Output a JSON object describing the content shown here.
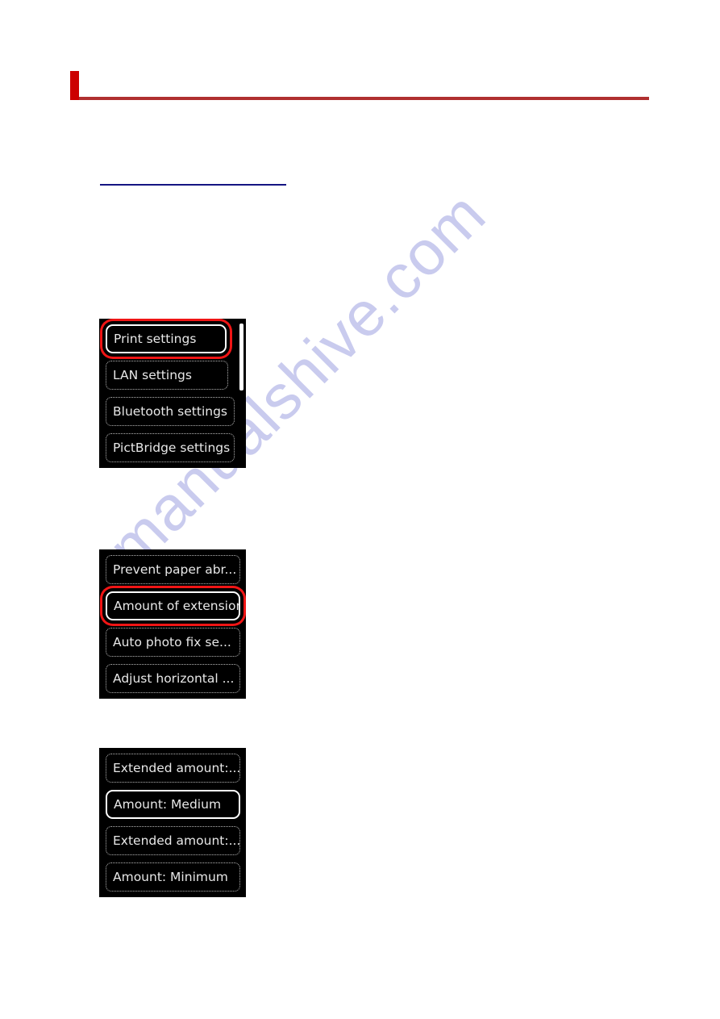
{
  "page": {
    "watermark": "manualshive.com",
    "accent_color": "#cc0000",
    "rule_color": "#b03030",
    "link_underline_color": "#141482",
    "lcd_background": "#000000",
    "lcd_text_color": "#e8e8e8",
    "lcd_selection_color": "#f01515"
  },
  "header": {
    "title": "",
    "accent_bar": "red-accent-bar"
  },
  "intro": {
    "text": "",
    "link_label": ""
  },
  "steps": [
    {
      "caption": ""
    },
    {
      "caption": ""
    },
    {
      "caption": ""
    }
  ],
  "lcd_screens": [
    {
      "name": "setup-menu",
      "scrollbar": {
        "visible": true,
        "thumb_top_pct": 0,
        "thumb_height_pct": 48
      },
      "items": [
        {
          "label": "Print settings",
          "state": "selected-red"
        },
        {
          "label": "LAN settings",
          "state": "normal"
        },
        {
          "label": "Bluetooth settings",
          "state": "normal"
        },
        {
          "label": "PictBridge settings",
          "state": "normal"
        }
      ]
    },
    {
      "name": "print-settings-menu",
      "scrollbar": {
        "visible": false,
        "thumb_top_pct": 0,
        "thumb_height_pct": 0
      },
      "items": [
        {
          "label": "Prevent paper abr...",
          "state": "normal"
        },
        {
          "label": "Amount of extension",
          "state": "selected-red"
        },
        {
          "label": "Auto photo fix se...",
          "state": "normal"
        },
        {
          "label": "Adjust horizontal ...",
          "state": "normal"
        }
      ]
    },
    {
      "name": "amount-of-extension-menu",
      "scrollbar": {
        "visible": false,
        "thumb_top_pct": 0,
        "thumb_height_pct": 0
      },
      "items": [
        {
          "label": "Extended amount:...",
          "state": "normal"
        },
        {
          "label": "Amount: Medium",
          "state": "selected-white"
        },
        {
          "label": "Extended amount:...",
          "state": "normal"
        },
        {
          "label": "Amount: Minimum",
          "state": "normal"
        }
      ]
    }
  ]
}
